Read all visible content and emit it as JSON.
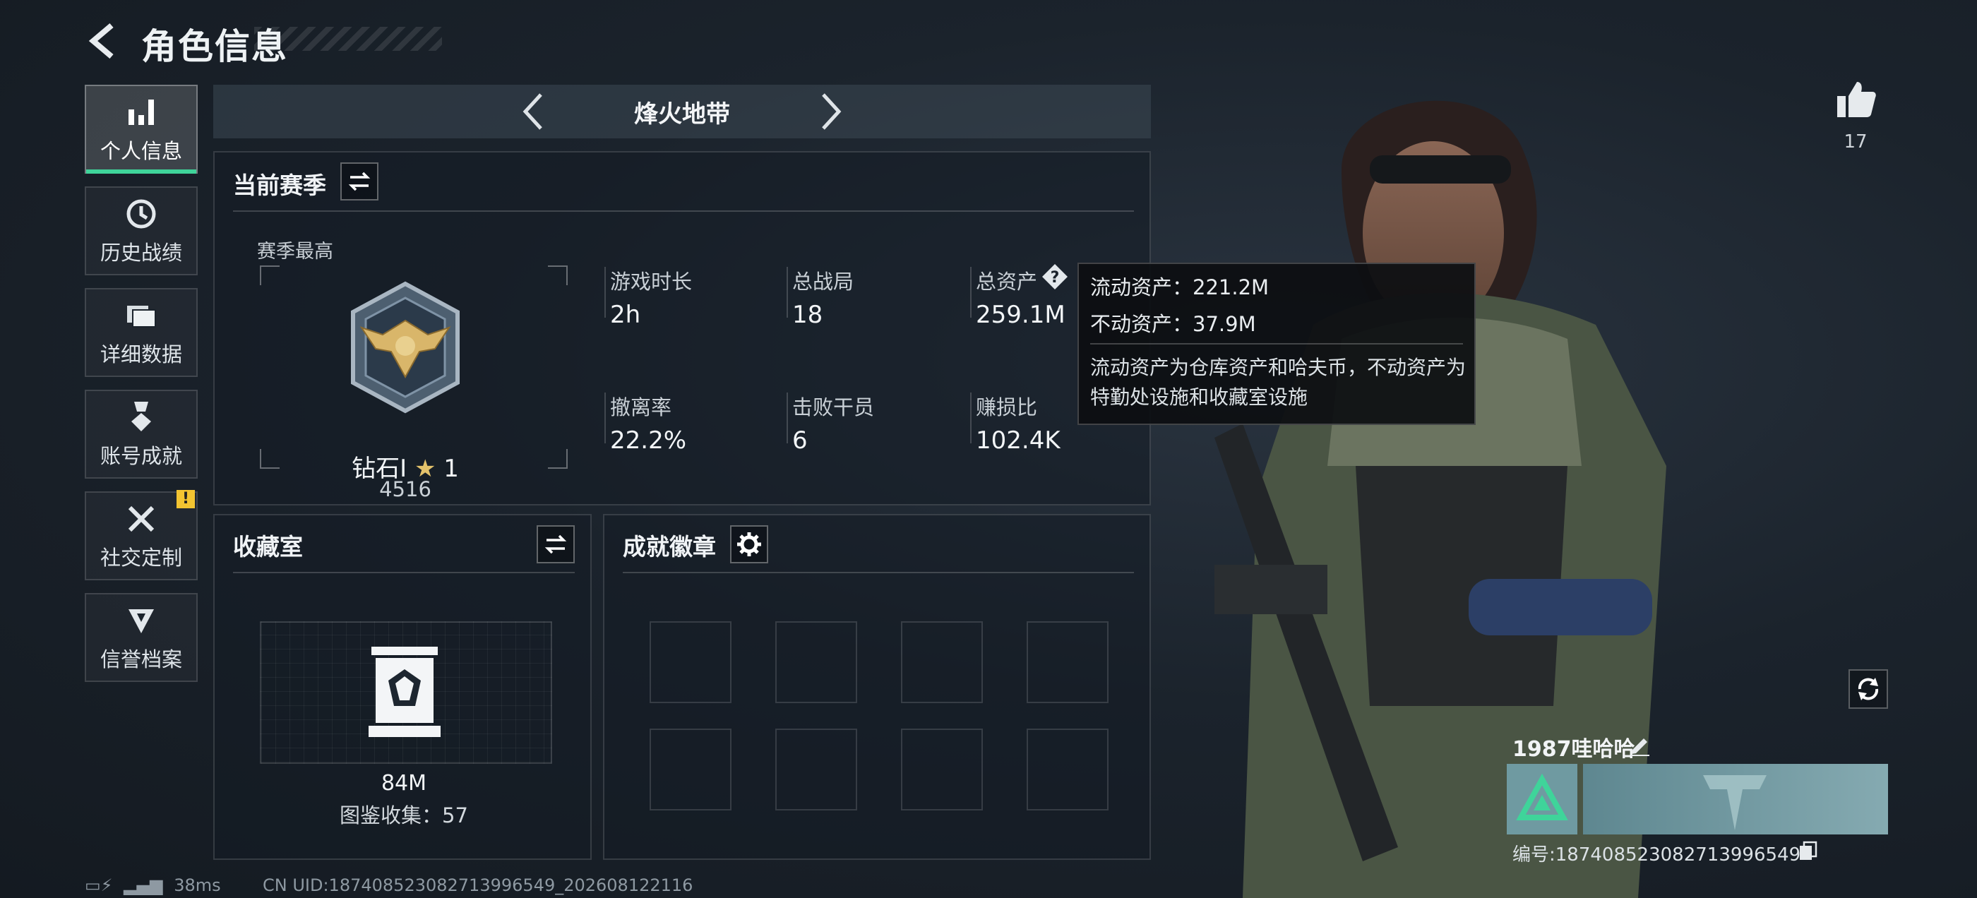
{
  "header": {
    "title": "角色信息"
  },
  "nav": {
    "items": [
      {
        "label": "个人信息",
        "icon": "bar-chart-icon",
        "active": true
      },
      {
        "label": "历史战绩",
        "icon": "history-clock-icon",
        "active": false
      },
      {
        "label": "详细数据",
        "icon": "folders-icon",
        "active": false
      },
      {
        "label": "账号成就",
        "icon": "medal-icon",
        "active": false
      },
      {
        "label": "社交定制",
        "icon": "wrench-screwdriver-icon",
        "active": false,
        "alert": "!"
      },
      {
        "label": "信誉档案",
        "icon": "shield-badge-icon",
        "active": false
      }
    ]
  },
  "mode": {
    "name": "烽火地带"
  },
  "season": {
    "title": "当前赛季",
    "best_label": "赛季最高",
    "rank_name": "钻石Ⅰ",
    "rank_stars": "1",
    "rank_score": "4516",
    "stats": [
      {
        "label": "游戏时长",
        "value": "2h"
      },
      {
        "label": "总战局",
        "value": "18"
      },
      {
        "label": "总资产",
        "value": "259.1M",
        "has_help": true,
        "help_icon": "?"
      },
      {
        "label": "撤离率",
        "value": "22.2%"
      },
      {
        "label": "击败干员",
        "value": "6"
      },
      {
        "label": "赚损比",
        "value": "102.4K"
      }
    ]
  },
  "tooltip": {
    "liquid": "流动资产：221.2M",
    "fixed": "不动资产：37.9M",
    "desc": "流动资产为仓库资产和哈夫币，不动资产为特勤处设施和收藏室设施"
  },
  "collection": {
    "title": "收藏室",
    "value": "84M",
    "collected": "图鉴收集：57"
  },
  "badges": {
    "title": "成就徽章",
    "slots": 8
  },
  "character": {
    "likes": "17"
  },
  "player": {
    "name": "1987哇哈哈",
    "id": "编号:187408523082713996549"
  },
  "status": {
    "ping": "38ms",
    "uid": "CN UID:187408523082713996549_202608122116"
  },
  "colors": {
    "accent": "#3fd49a",
    "alert": "#f3c431",
    "bg": "#1b232c"
  }
}
